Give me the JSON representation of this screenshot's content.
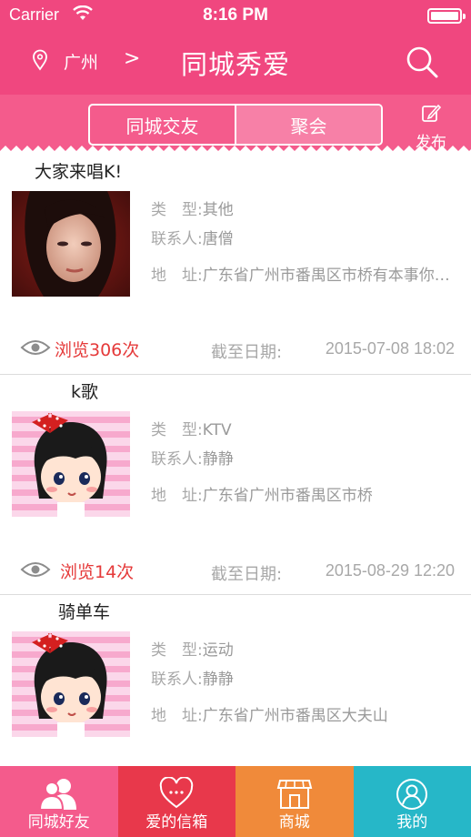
{
  "status_bar": {
    "carrier": "Carrier",
    "time": "8:16 PM"
  },
  "nav": {
    "city": "广州",
    "chevron": ">",
    "title": "同城秀爱",
    "search_icon": "search-icon"
  },
  "segment": {
    "options": [
      "同城交友",
      "聚会"
    ],
    "selected_index": 1
  },
  "publish": {
    "label": "发布",
    "icon": "edit-icon"
  },
  "colors": {
    "brand": "#f0477f",
    "segment_bg": "#f45b8c",
    "views": "#e53a3a",
    "tab_friends": "#f45b8c",
    "tab_mail": "#e8384b",
    "tab_shop": "#f08a3a",
    "tab_me": "#26b7c8"
  },
  "list": [
    {
      "title": "大家来唱K!",
      "type_key": "类　型:",
      "type_value": "其他",
      "contact_key": "联系人:",
      "contact_value": "唐僧",
      "address_key": "地　址:",
      "address_value": "广东省广州市番禺区市桥有本事你…",
      "views": "浏览306次",
      "deadline_key": "截至日期:",
      "deadline_value": "2015-07-08 18:02",
      "image": "photo-woman"
    },
    {
      "title": "k歌",
      "type_key": "类　型:",
      "type_value": "KTV",
      "contact_key": "联系人:",
      "contact_value": "静静",
      "address_key": "地　址:",
      "address_value": "广东省广州市番禺区市桥",
      "views": "浏览14次",
      "deadline_key": "截至日期:",
      "deadline_value": "2015-08-29 12:20",
      "image": "cartoon-girl"
    },
    {
      "title": "骑单车",
      "type_key": "类　型:",
      "type_value": "运动",
      "contact_key": "联系人:",
      "contact_value": "静静",
      "address_key": "地　址:",
      "address_value": "广东省广州市番禺区大夫山",
      "image": "cartoon-girl"
    }
  ],
  "tabs": [
    {
      "label": "同城好友",
      "icon": "friends-icon"
    },
    {
      "label": "爱的信箱",
      "icon": "heart-mail-icon"
    },
    {
      "label": "商城",
      "icon": "shop-icon"
    },
    {
      "label": "我的",
      "icon": "profile-icon"
    }
  ]
}
